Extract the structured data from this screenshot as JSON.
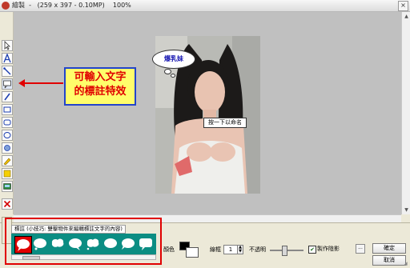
{
  "window": {
    "title": "繪製",
    "image_info": "(259 x 397 - 0.10MP)",
    "zoom": "100%",
    "close_glyph": "×"
  },
  "toolbar": {
    "tools": [
      {
        "icon": "pointer-icon"
      },
      {
        "icon": "text-icon"
      },
      {
        "icon": "line-icon"
      },
      {
        "icon": "callout-icon"
      },
      {
        "icon": "pencil-icon"
      },
      {
        "icon": "rectangle-icon"
      },
      {
        "icon": "rounded-rectangle-icon"
      },
      {
        "icon": "ellipse-icon"
      },
      {
        "icon": "blur-icon"
      },
      {
        "icon": "highlighter-icon"
      },
      {
        "icon": "stamp-icon"
      },
      {
        "icon": "image-icon"
      },
      {
        "icon": "delete-icon"
      }
    ]
  },
  "canvas": {
    "callout_bubble_text": "爆乳妹",
    "caption_box_text": "按一下以命名"
  },
  "annotation": {
    "line1": "可輸入文字",
    "line2": "的標註特效",
    "colors": {
      "text": "#e00000",
      "background": "#fffd6b",
      "border": "#2244cc"
    }
  },
  "bottom_panel": {
    "tab_label": "標註 (小技巧: 雙擊物件來編輯標註文字的內容)",
    "color_label": "顏色",
    "line_width_label": "線框",
    "line_width_value": "1",
    "opacity_label": "不透明",
    "shadow_label": "製作陰影",
    "shadow_checked": true,
    "check_glyph": "✔",
    "more_glyph": "...",
    "spin_glyph_up": "▲",
    "spin_glyph_down": "▼",
    "ok_label": "確定",
    "cancel_label": "取消",
    "callout_styles": [
      {
        "icon": "callout-style-1-icon",
        "selected": true
      },
      {
        "icon": "callout-style-2-icon"
      },
      {
        "icon": "callout-style-3-icon"
      },
      {
        "icon": "callout-style-4-icon"
      },
      {
        "icon": "callout-style-5-icon"
      },
      {
        "icon": "callout-style-6-icon"
      },
      {
        "icon": "callout-style-7-icon"
      },
      {
        "icon": "callout-style-8-icon"
      }
    ]
  }
}
